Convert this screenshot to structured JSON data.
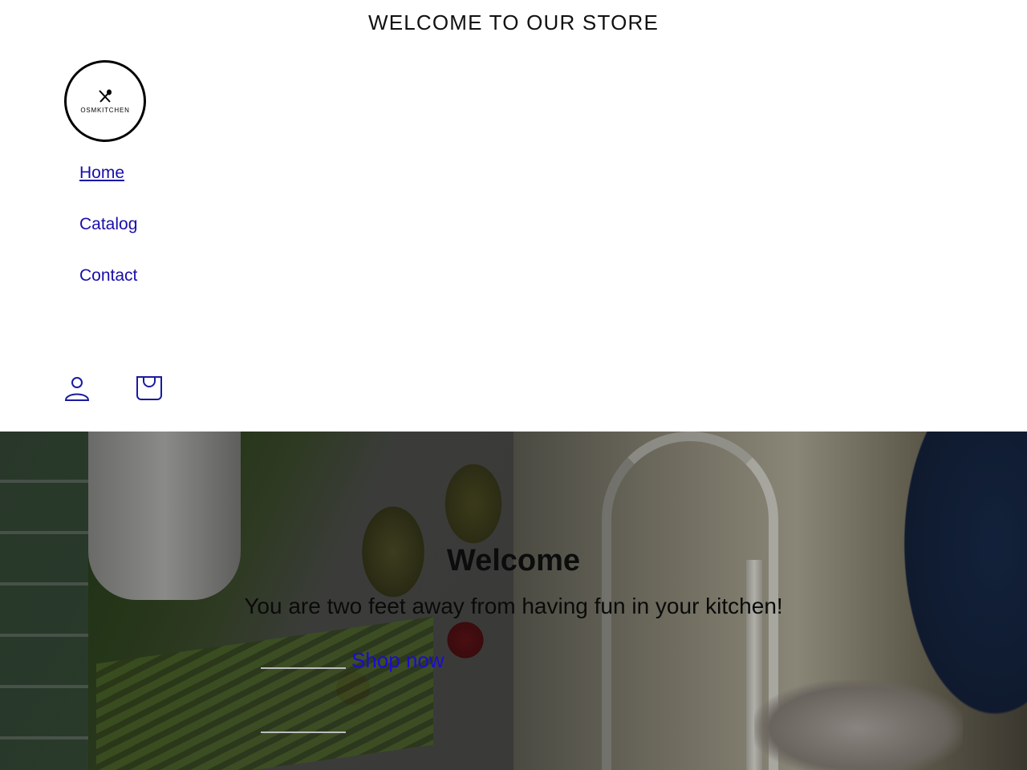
{
  "announcement": {
    "text": "WELCOME TO OUR STORE"
  },
  "header": {
    "logo": {
      "brand": "OSMKITCHEN"
    },
    "nav": [
      {
        "label": "Home",
        "active": true
      },
      {
        "label": "Catalog",
        "active": false
      },
      {
        "label": "Contact",
        "active": false
      }
    ],
    "icons": {
      "account": "user-icon",
      "cart": "shopping-bag-icon"
    }
  },
  "hero": {
    "title": "Welcome",
    "subtitle": "You are two feet away from having fun in your kitchen!",
    "cta_label": "Shop now"
  },
  "colors": {
    "link": "#1a0dab",
    "text": "#000000",
    "background": "#ffffff"
  }
}
